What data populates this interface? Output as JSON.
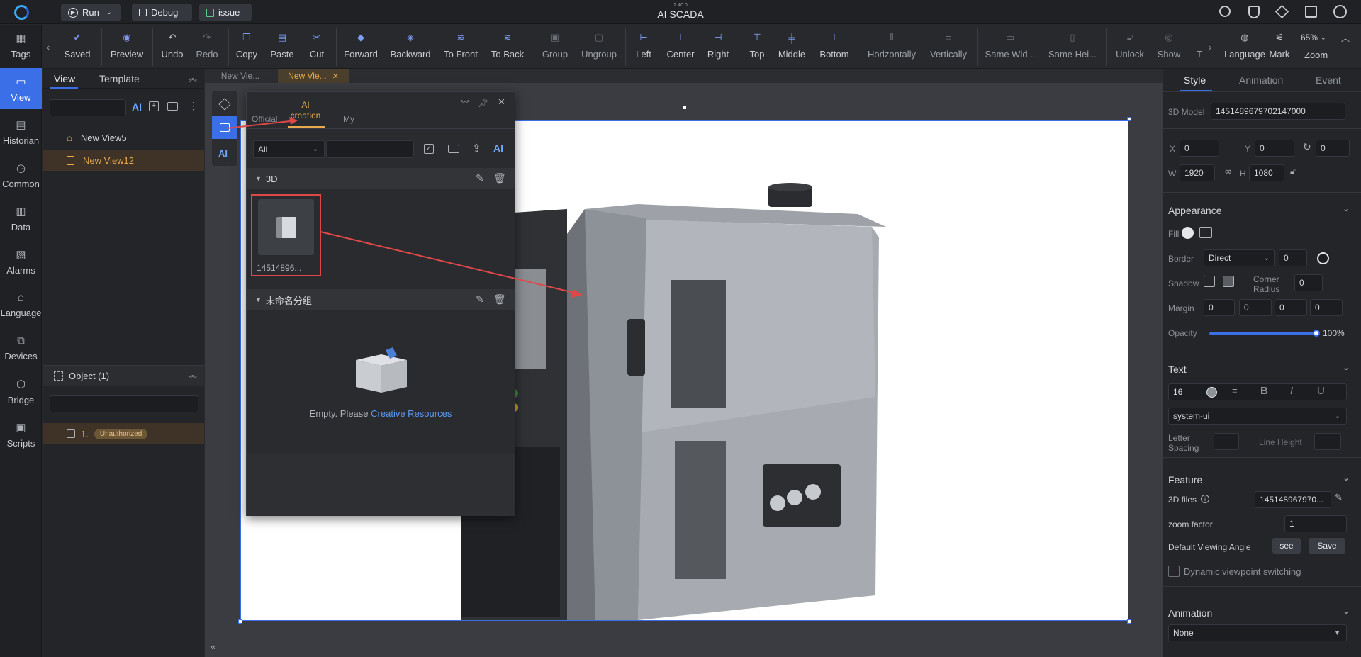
{
  "header": {
    "version": "2.40.0",
    "title": "AI SCADA",
    "run_label": "Run",
    "debug_label": "Debug",
    "issue_label": "issue"
  },
  "toolbar": {
    "items": [
      {
        "label": "Saved"
      },
      {
        "label": "Preview"
      },
      {
        "label": "Undo"
      },
      {
        "label": "Redo"
      },
      {
        "label": "Copy"
      },
      {
        "label": "Paste"
      },
      {
        "label": "Cut"
      },
      {
        "label": "Forward"
      },
      {
        "label": "Backward"
      },
      {
        "label": "To Front"
      },
      {
        "label": "To Back"
      },
      {
        "label": "Group"
      },
      {
        "label": "Ungroup"
      },
      {
        "label": "Left"
      },
      {
        "label": "Center"
      },
      {
        "label": "Right"
      },
      {
        "label": "Top"
      },
      {
        "label": "Middle"
      },
      {
        "label": "Bottom"
      },
      {
        "label": "Horizontally"
      },
      {
        "label": "Vertically"
      },
      {
        "label": "Same Wid..."
      },
      {
        "label": "Same Hei..."
      },
      {
        "label": "Unlock"
      },
      {
        "label": "Show"
      },
      {
        "label": "T"
      }
    ],
    "right": {
      "language": "Language",
      "mark": "Mark",
      "zoom_label": "Zoom",
      "zoom_value": "65%"
    }
  },
  "nav": [
    {
      "label": "Tags",
      "icon": "tags-icon"
    },
    {
      "label": "View",
      "icon": "view-icon"
    },
    {
      "label": "Historian",
      "icon": "historian-icon"
    },
    {
      "label": "Common",
      "icon": "common-icon"
    },
    {
      "label": "Data",
      "icon": "data-icon"
    },
    {
      "label": "Alarms",
      "icon": "alarms-icon"
    },
    {
      "label": "Language",
      "icon": "language-icon"
    },
    {
      "label": "Devices",
      "icon": "devices-icon"
    },
    {
      "label": "Bridge",
      "icon": "bridge-icon"
    },
    {
      "label": "Scripts",
      "icon": "scripts-icon"
    }
  ],
  "view_panel": {
    "tabs": [
      "View",
      "Template"
    ],
    "ai_label": "AI",
    "tree": [
      {
        "label": "New View5"
      },
      {
        "label": "New View12"
      }
    ],
    "object_header": "Object (1)",
    "object_item": {
      "index": "1.",
      "badge": "Unauthorized"
    }
  },
  "doc_tabs": [
    "New Vie...",
    "New Vie..."
  ],
  "library": {
    "tabs": [
      "Official",
      "AI creation",
      "My"
    ],
    "ai_tab_line1": "AI",
    "ai_tab_line2": "creation",
    "filter": "All",
    "ai_label": "AI",
    "group1": "3D",
    "item_label": "14514896...",
    "group2": "未命名分组",
    "empty_text": "Empty. Please",
    "empty_link": "Creative Resources"
  },
  "right_panel": {
    "tabs": [
      "Style",
      "Animation",
      "Event"
    ],
    "model_label": "3D Model",
    "model_value": "1451489679702147000",
    "x_label": "X",
    "x": "0",
    "y_label": "Y",
    "y": "0",
    "rot": "0",
    "w_label": "W",
    "w": "1920",
    "h_label": "H",
    "h": "1080",
    "appearance": "Appearance",
    "fill": "Fill",
    "border": "Border",
    "border_type": "Direct",
    "border_width": "0",
    "shadow": "Shadow",
    "corner_radius_1": "Corner",
    "corner_radius_2": "Radius",
    "corner_value": "0",
    "margin": "Margin",
    "margins": [
      "0",
      "0",
      "0",
      "0"
    ],
    "opacity": "Opacity",
    "opacity_value": "100%",
    "text": "Text",
    "font_size": "16",
    "font_family": "system-ui",
    "letter_1": "Letter",
    "letter_2": "Spacing",
    "line_height": "Line Height",
    "feature": "Feature",
    "files_label": "3D files",
    "files_value": "145148967970...",
    "zoom_factor_label": "zoom factor",
    "zoom_factor": "1",
    "viewing_label": "Default Viewing Angle",
    "see": "see",
    "save": "Save",
    "dynamic": "Dynamic viewpoint switching",
    "animation": "Animation",
    "animation_value": "None"
  },
  "colors": {
    "accent": "#3b6fe8",
    "orange": "#e8a94f",
    "highlight": "#e04848"
  }
}
